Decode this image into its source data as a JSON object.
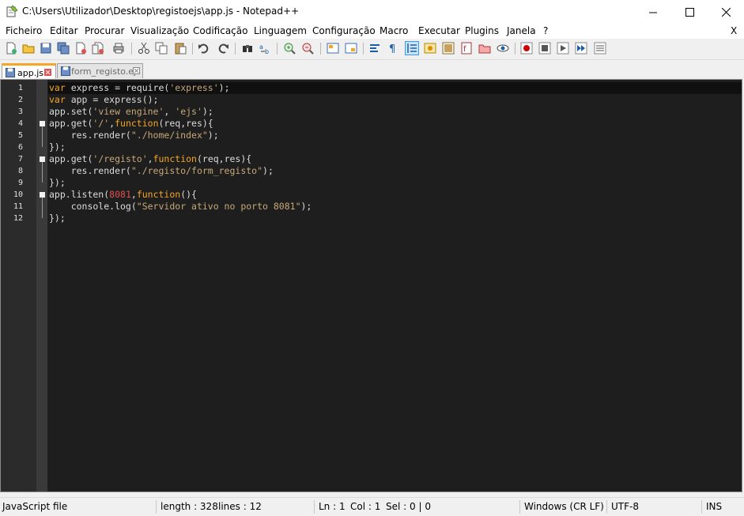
{
  "window": {
    "title": "C:\\Users\\Utilizador\\Desktop\\registoejs\\app.js - Notepad++",
    "minimize_label": "—",
    "maximize_label": "☐",
    "close_label": "✕"
  },
  "menu": {
    "items": [
      "Ficheiro",
      "Editar",
      "Procurar",
      "Visualização",
      "Codificação",
      "Linguagem",
      "Configuração",
      "Macro",
      "Executar",
      "Plugins",
      "Janela",
      "?"
    ],
    "close_doc": "X"
  },
  "tabs": [
    {
      "label": "app.js",
      "active": true
    },
    {
      "label": "form_registo.ejs",
      "active": false
    }
  ],
  "editor": {
    "line_numbers": [
      "1",
      "2",
      "3",
      "4",
      "5",
      "6",
      "7",
      "8",
      "9",
      "10",
      "11",
      "12"
    ],
    "lines": [
      "var express = require('express');",
      "var app = express();",
      "app.set('view engine', 'ejs');",
      "app.get('/',function(req,res){",
      "    res.render(\"./home/index\");",
      "});",
      "app.get('/registo',function(req,res){",
      "    res.render(\"./registo/form_registo\");",
      "});",
      "app.listen(8081,function(){",
      "    console.log(\"Servidor ativo no porto 8081\");",
      "});"
    ],
    "current_line": 1,
    "fold_lines": [
      4,
      7,
      10
    ]
  },
  "status": {
    "filetype": "JavaScript file",
    "length": "length : 328",
    "lines": "lines : 12",
    "ln": "Ln : 1",
    "col": "Col : 1",
    "sel": "Sel : 0 | 0",
    "eol": "Windows (CR LF)",
    "encoding": "UTF-8",
    "mode": "INS"
  },
  "toolbar_icons": [
    "new-file-icon",
    "open-file-icon",
    "save-icon",
    "save-all-icon",
    "close-icon",
    "close-all-icon",
    "print-icon",
    "cut-icon",
    "copy-icon",
    "paste-icon",
    "undo-icon",
    "redo-icon",
    "find-icon",
    "replace-icon",
    "zoom-in-icon",
    "zoom-out-icon",
    "sync-v-icon",
    "sync-h-icon",
    "word-wrap-icon",
    "show-all-chars-icon",
    "indent-guide-icon",
    "udl-icon",
    "doc-map-icon",
    "function-list-icon",
    "folder-workspace-icon",
    "monitoring-icon",
    "record-macro-icon",
    "stop-record-icon",
    "play-macro-icon",
    "run-multiple-icon",
    "save-macro-icon"
  ],
  "colors": {
    "editor_bg": "#1e1e1e",
    "keyword": "#f5a623",
    "string": "#c8a878",
    "number": "#e05050",
    "text": "#dcdcdc"
  }
}
